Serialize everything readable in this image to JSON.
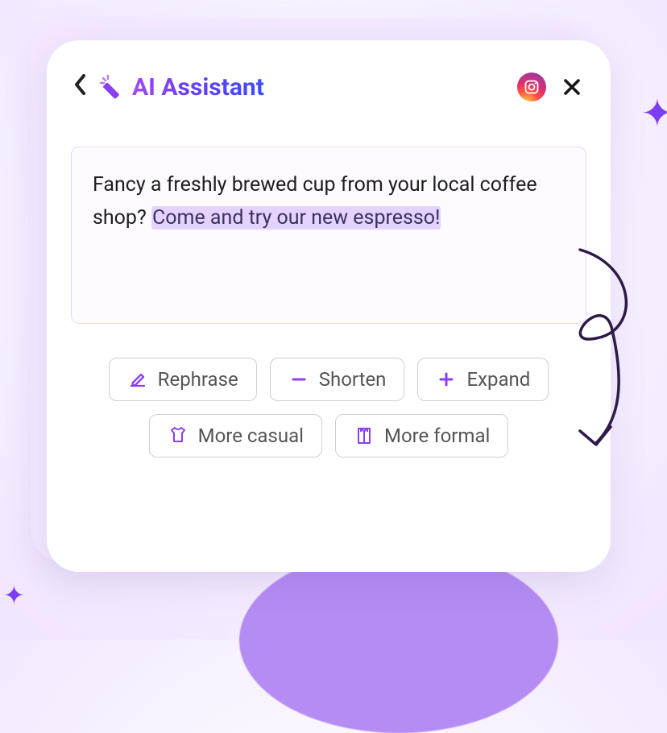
{
  "header": {
    "title": "AI Assistant"
  },
  "content": {
    "plain_text": "Fancy a freshly brewed cup from your local coffee shop? ",
    "highlighted_text": "Come and try our new espresso!"
  },
  "actions": {
    "rephrase": "Rephrase",
    "shorten": "Shorten",
    "expand": "Expand",
    "more_casual": "More casual",
    "more_formal": "More formal"
  },
  "colors": {
    "accent_purple": "#8b3ff5",
    "highlight_bg": "#e5d3ff"
  }
}
